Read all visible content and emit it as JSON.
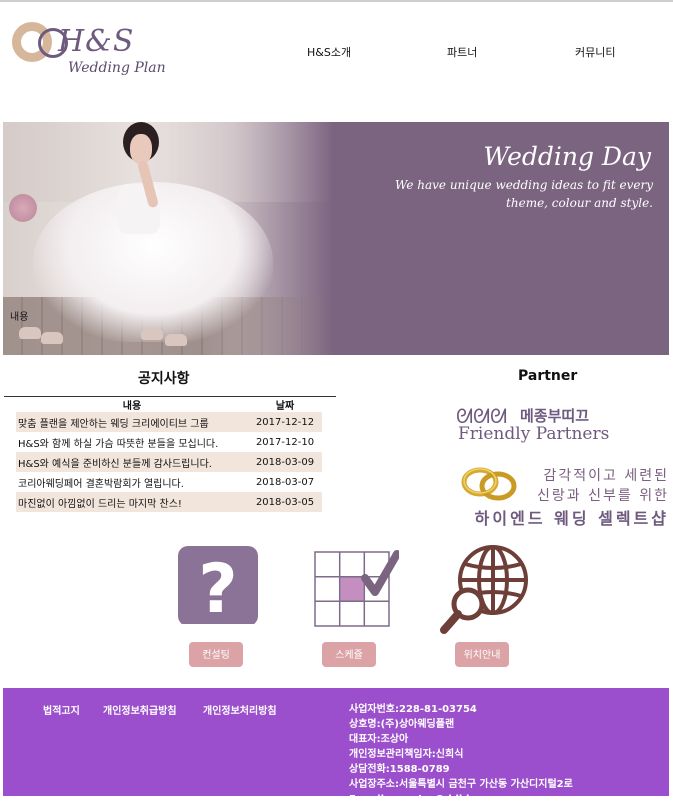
{
  "header": {
    "logo_brand": "H&S",
    "logo_sub": "Wedding Plan",
    "nav": [
      "H&S소개",
      "파트너",
      "커뮤니티"
    ]
  },
  "hero": {
    "title": "Wedding Day",
    "tagline": "We have unique wedding ideas to fit every theme, colour and style.",
    "caption": "내용"
  },
  "notices": {
    "title": "공지사항",
    "columns": [
      "내용",
      "날짜"
    ],
    "rows": [
      {
        "text": "맞춤 플랜을 제안하는 웨딩 크리에이티브 그룹",
        "date": "2017-12-12"
      },
      {
        "text": "H&S와 함께 하실 가슴 따뜻한 분들을 모십니다.",
        "date": "2017-12-10"
      },
      {
        "text": "H&S와 예식을 준비하신 분들께 감사드립니다.",
        "date": "2018-03-09"
      },
      {
        "text": "코리아웨딩페어 결혼박람회가 열립니다.",
        "date": "2018-03-07"
      },
      {
        "text": "마진없이 아낌없이 드리는 마지막 찬스!",
        "date": "2018-03-05"
      }
    ]
  },
  "partner": {
    "title": "Partner",
    "logo_kr": "메종부띠끄",
    "logo_en": "Friendly Partners",
    "copy_line1": "감각적이고 세련된",
    "copy_line2": "신랑과 신부를 위한",
    "copy_line3": "하이엔드 웨딩 셀렉트샵"
  },
  "features": [
    {
      "label": "컨설팅",
      "icon": "question-icon"
    },
    {
      "label": "스케쥴",
      "icon": "calendar-check-icon"
    },
    {
      "label": "위치안내",
      "icon": "globe-search-icon"
    }
  ],
  "footer": {
    "links": [
      "법적고지",
      "개인정보취급방침",
      "개인정보처리방침"
    ],
    "info": [
      "사업자번호:228-81-03754",
      "상호명:(주)상아웨딩플랜",
      "대표자:조상아",
      "개인정보관리책임자:신희식",
      "상담전화:1588-0789",
      "사업장주소:서울특별시 금천구 가산동 가산디지털2로",
      "E-mail : master@ddbb.com"
    ]
  },
  "colors": {
    "hero_bg": "#7b6480",
    "accent_purple": "#6e5a7e",
    "notice_row": "#f2e5dc",
    "button_pink": "#dba3a6",
    "footer_bg": "#9b4fcc"
  }
}
